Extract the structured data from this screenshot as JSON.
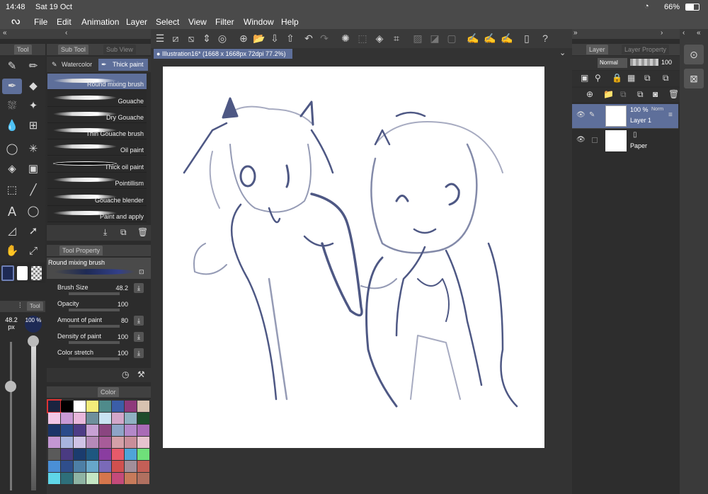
{
  "status": {
    "time": "14:48",
    "date": "Sat 19 Oct",
    "battery": "66%"
  },
  "menu": [
    "File",
    "Edit",
    "Animation",
    "Layer",
    "Select",
    "View",
    "Filter",
    "Window",
    "Help"
  ],
  "doc_tab": "Illustration16* (1668 x 1668px 72dpi 77.2%)",
  "left": {
    "tool_tab": "Tool",
    "subtool_tab": "Sub Tool",
    "subview_tab": "Sub View",
    "groups": [
      "Watercolor",
      "Thick paint"
    ],
    "brushes": [
      "Round mixing brush",
      "Gouache",
      "Dry Gouache",
      "Thin Gouache brush",
      "Oil paint",
      "Thick oil paint",
      "Pointillism",
      "Gouache blender",
      "Paint and apply"
    ],
    "tool_property_tab": "Tool Property",
    "current_brush": "Round mixing brush",
    "props": [
      {
        "label": "Brush Size",
        "value": "48.2"
      },
      {
        "label": "Opacity",
        "value": "100"
      },
      {
        "label": "Amount of paint",
        "value": "80"
      },
      {
        "label": "Density of paint",
        "value": "100"
      },
      {
        "label": "Color stretch",
        "value": "100"
      }
    ],
    "size_readout": "48.2 px",
    "opacity_readout": "100 %",
    "mini_tab": "Tool",
    "color_tab": "Color"
  },
  "colors": {
    "accent": "#5e6f9a",
    "main_color": "#1e2a55",
    "swatches": [
      "#1b2440",
      "#000000",
      "#ffffff",
      "#f3ec7a",
      "#4f8b8b",
      "#3b5ea8",
      "#8e3a7b",
      "#d7c2b0",
      "#f2c6e6",
      "#c89ad6",
      "#e8b7dc",
      "#6e8f9c",
      "#c9e3f2",
      "#d3a6c9",
      "#8fb1c2",
      "#1f4c2b",
      "#1c3468",
      "#2a4b8a",
      "#4d3c86",
      "#c7a1d4",
      "#8a4580",
      "#8ea4c7",
      "#b388c9",
      "#a96bb6",
      "#c497d3",
      "#a7b4de",
      "#cfc3e6",
      "#b58ab8",
      "#a85c99",
      "#d4a0a8",
      "#c98e9a",
      "#e7c3cf",
      "#5a5a5a",
      "#4a3b82",
      "#1b3c6e",
      "#1e5780",
      "#8a3da0",
      "#e65a6a",
      "#4fa4d8",
      "#6fe07a",
      "#4a8fd6",
      "#2f4e8c",
      "#4d7fa6",
      "#67a6c9",
      "#7a6ab8",
      "#d0504f",
      "#a28e9a",
      "#c45f57",
      "#5fd6e8",
      "#2e6f7a",
      "#8fb4a4",
      "#c4e6c4",
      "#d6764c",
      "#c44a7a",
      "#c77a5a",
      "#b07060"
    ]
  },
  "layers": {
    "tab": "Layer",
    "tab2": "Layer Property",
    "blend": "Normal",
    "opacity": "100",
    "items": [
      {
        "name": "Layer 1",
        "opacity": "100 %",
        "mode": "Norm"
      },
      {
        "name": "Paper"
      }
    ]
  }
}
